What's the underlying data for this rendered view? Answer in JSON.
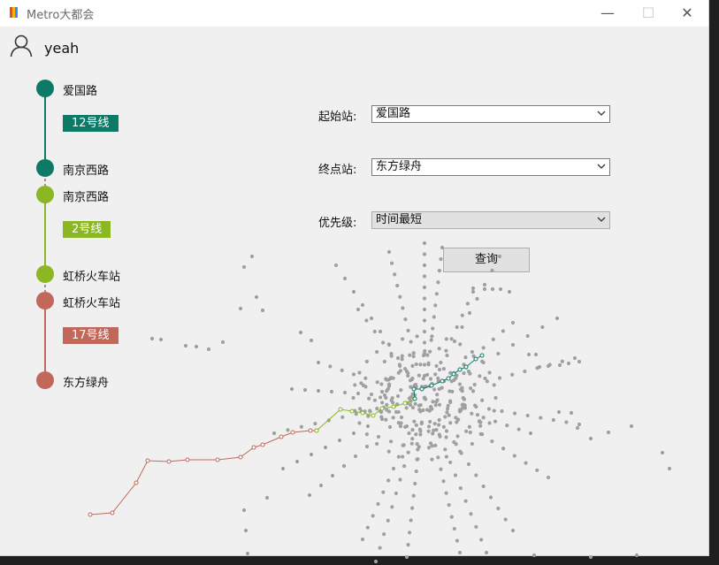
{
  "window": {
    "title": "Metro大都会",
    "minimize_glyph": "—",
    "maximize_glyph": "☐",
    "close_glyph": "✕"
  },
  "user": {
    "name": "yeah",
    "icon": "user-icon"
  },
  "route": {
    "segments": [
      {
        "line": "12号线",
        "color": "#0c7a66",
        "from": "爱国路",
        "to": "南京西路"
      },
      {
        "line": "2号线",
        "color": "#8ab723",
        "from": "南京西路",
        "to": "虹桥火车站"
      },
      {
        "line": "17号线",
        "color": "#c2685a",
        "from": "虹桥火车站",
        "to": "东方绿舟"
      }
    ]
  },
  "form": {
    "start_label": "起始站:",
    "start_value": "爱国路",
    "end_label": "终点站:",
    "end_value": "东方绿舟",
    "priority_label": "优先级:",
    "priority_value": "时间最短",
    "query_button": "查询"
  },
  "map": {
    "station_color": "#a0a0a0",
    "line_colors": {
      "line12": "#0c7a66",
      "line2": "#8ab723",
      "line17": "#c2685a"
    }
  }
}
